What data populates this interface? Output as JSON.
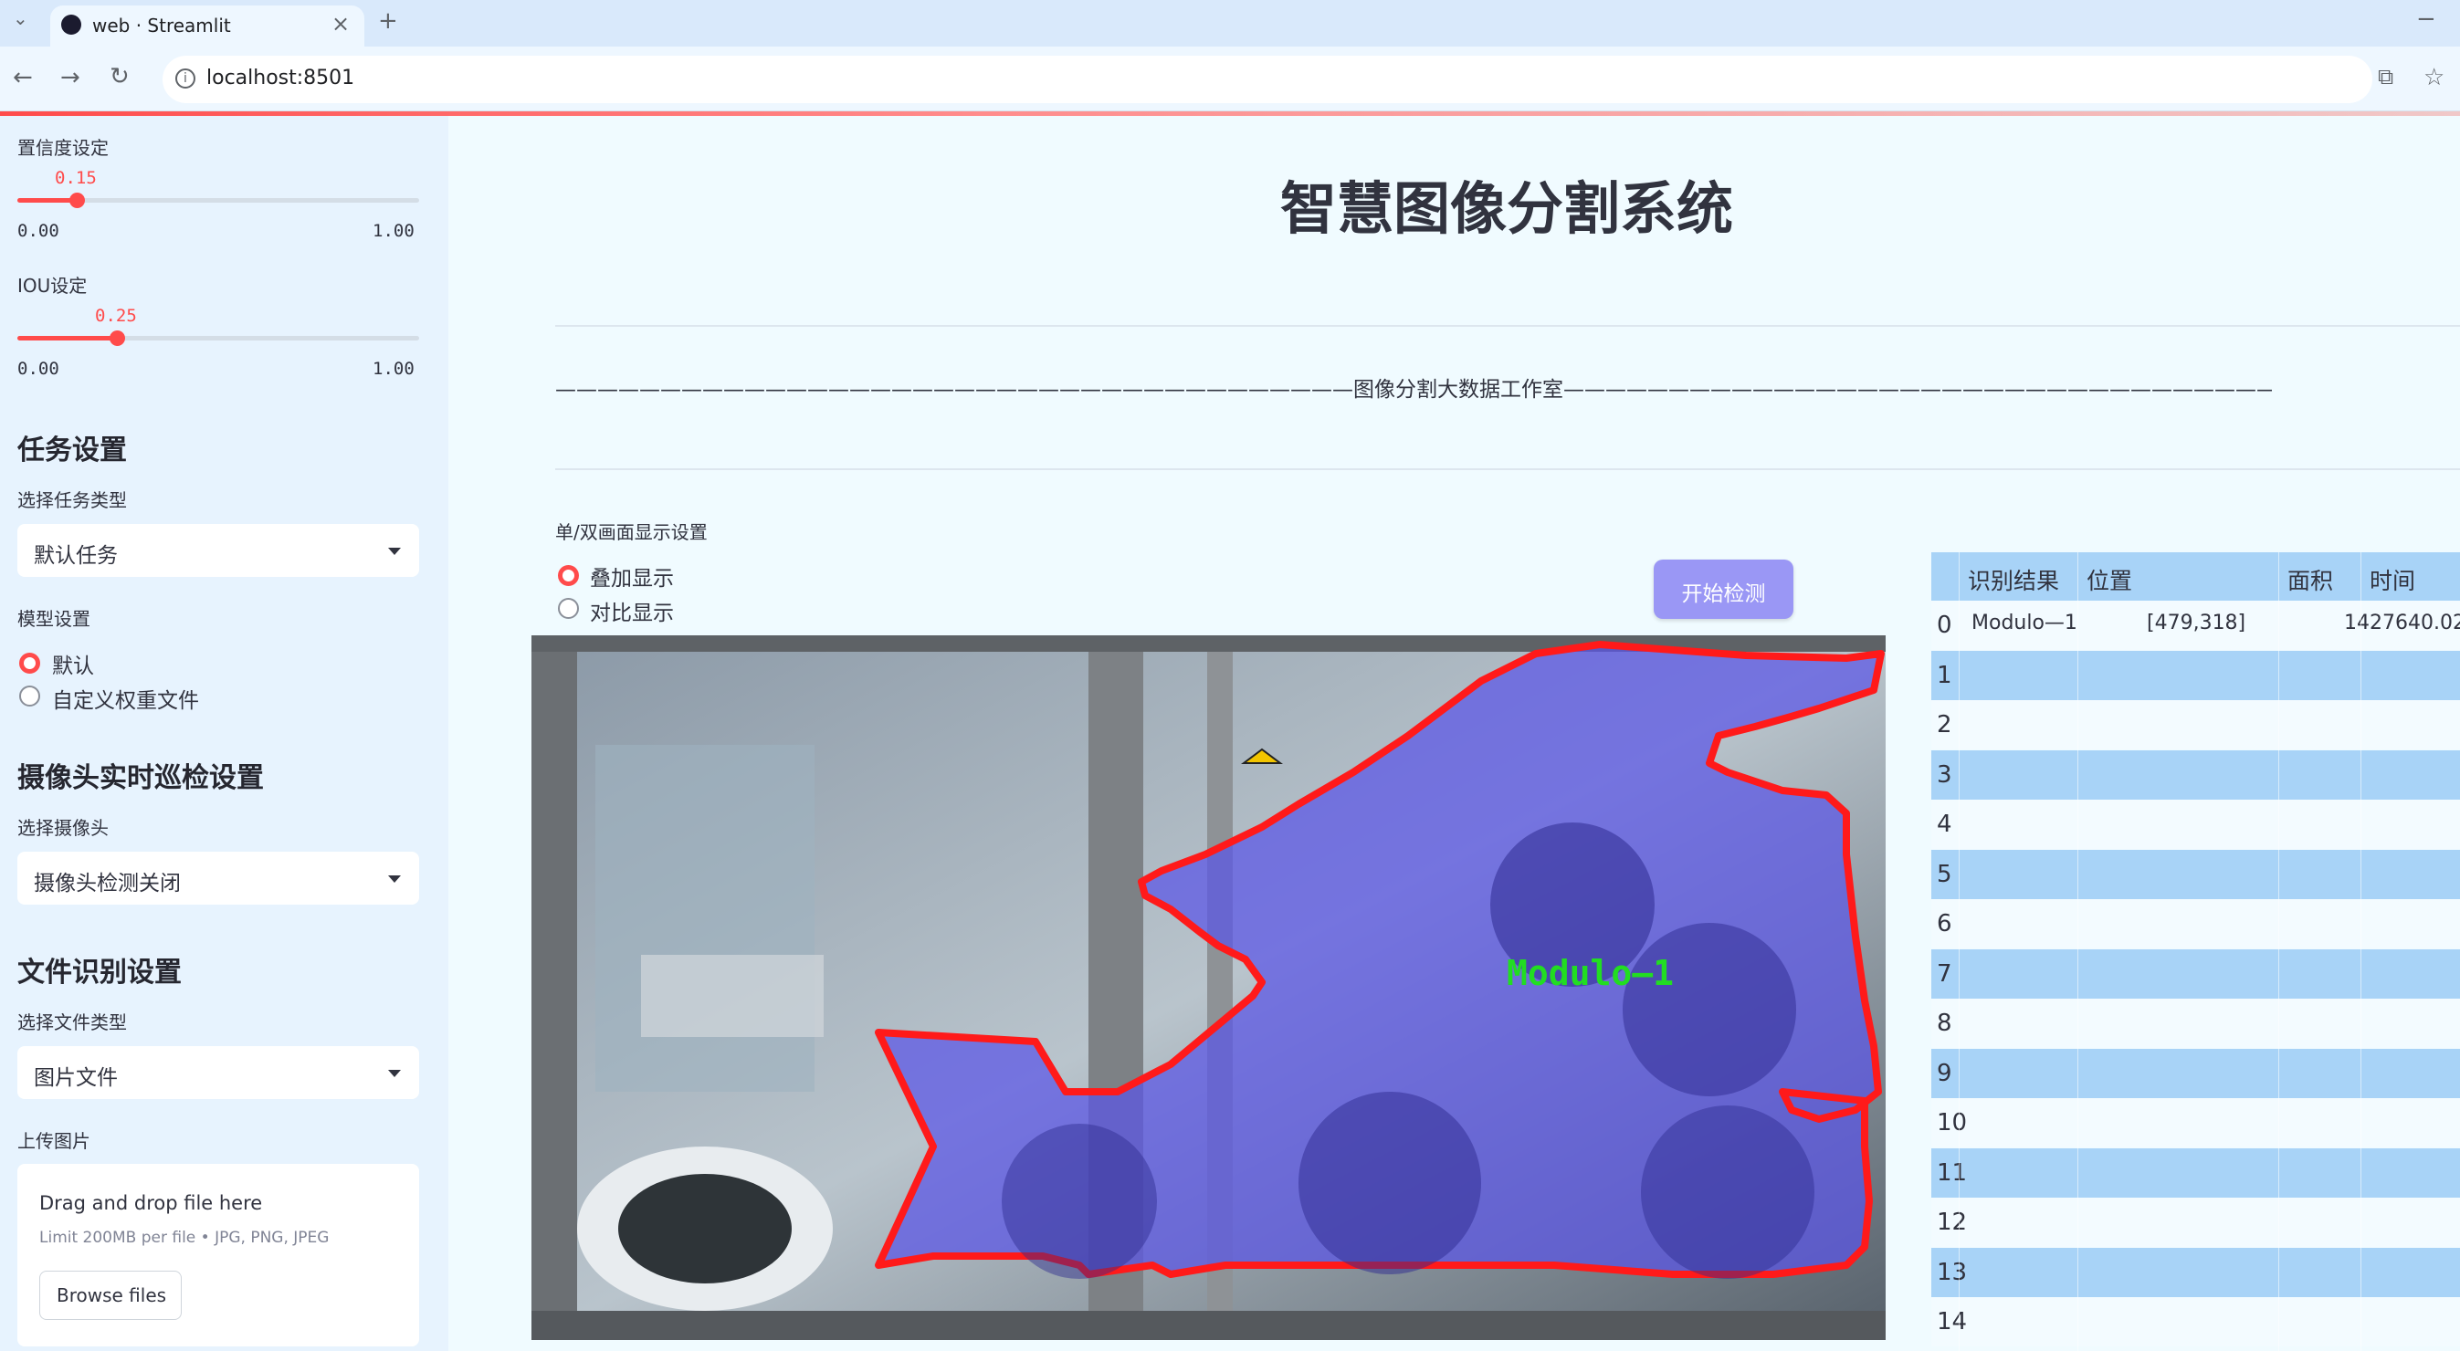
{
  "browser": {
    "tab_title": "web · Streamlit",
    "url": "localhost:8501"
  },
  "sidebar": {
    "confidence": {
      "label": "置信度设定",
      "value": 0.15,
      "value_text": "0.15",
      "min": "0.00",
      "max": "1.00"
    },
    "iou": {
      "label": "IOU设定",
      "value": 0.25,
      "value_text": "0.25",
      "min": "0.00",
      "max": "1.00"
    },
    "task_section": {
      "heading": "任务设置",
      "select_label": "选择任务类型",
      "selected": "默认任务"
    },
    "model_section": {
      "label": "模型设置",
      "options": [
        "默认",
        "自定义权重文件"
      ],
      "selected_index": 0
    },
    "camera_section": {
      "heading": "摄像头实时巡检设置",
      "select_label": "选择摄像头",
      "selected": "摄像头检测关闭"
    },
    "file_section": {
      "heading": "文件识别设置",
      "select_label": "选择文件类型",
      "selected": "图片文件"
    },
    "upload": {
      "label": "上传图片",
      "drop_text": "Drag and drop file here",
      "limit_text": "Limit 200MB per file • JPG, PNG, JPEG",
      "browse_label": "Browse files"
    }
  },
  "main": {
    "title": "智慧图像分割系统",
    "banner": "——————————————————————————————————————图像分割大数据工作室——————————————————————————————————————",
    "display_mode": {
      "label": "单/双画面显示设置",
      "options": [
        "叠加显示",
        "对比显示"
      ],
      "selected_index": 0
    },
    "start_button": "开始检测",
    "image": {
      "detection_label": "Modulo—1",
      "mask_color": "#5a54e6",
      "outline_color": "#ff1a1a",
      "label_color": "#22dd22"
    }
  },
  "results_table": {
    "headers": [
      "识别结果",
      "位置",
      "面积",
      "时间"
    ],
    "rows": [
      {
        "index": "0",
        "result": "Modulo—1",
        "position": "[479,318]",
        "area": "1427640.02",
        "time": ""
      },
      {
        "index": "1"
      },
      {
        "index": "2"
      },
      {
        "index": "3"
      },
      {
        "index": "4"
      },
      {
        "index": "5"
      },
      {
        "index": "6"
      },
      {
        "index": "7"
      },
      {
        "index": "8"
      },
      {
        "index": "9"
      },
      {
        "index": "10"
      },
      {
        "index": "11"
      },
      {
        "index": "12"
      },
      {
        "index": "13"
      },
      {
        "index": "14"
      }
    ]
  }
}
